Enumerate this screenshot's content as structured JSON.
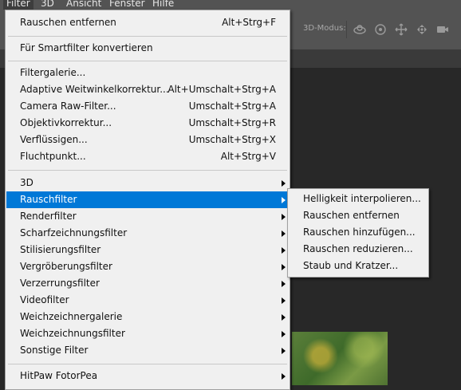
{
  "menubar": {
    "items": [
      "Filter",
      "3D",
      "Ansicht",
      "Fenster",
      "Hilfe"
    ]
  },
  "options_bar": {
    "mode_label": "3D-Modus:",
    "icons": [
      "orbit-icon",
      "roll-icon",
      "pan-icon",
      "slide-icon",
      "camera-icon"
    ]
  },
  "menu": {
    "items": [
      {
        "label": "Rauschen entfernen",
        "shortcut": "Alt+Strg+F"
      },
      {
        "label": "Für Smartfilter konvertieren",
        "shortcut": ""
      },
      {
        "label": "Filtergalerie...",
        "shortcut": ""
      },
      {
        "label": "Adaptive Weitwinkelkorrektur...",
        "shortcut": "Alt+Umschalt+Strg+A"
      },
      {
        "label": "Camera Raw-Filter...",
        "shortcut": "Umschalt+Strg+A"
      },
      {
        "label": "Objektivkorrektur...",
        "shortcut": "Umschalt+Strg+R"
      },
      {
        "label": "Verflüssigen...",
        "shortcut": "Umschalt+Strg+X"
      },
      {
        "label": "Fluchtpunkt...",
        "shortcut": "Alt+Strg+V"
      },
      {
        "label": "3D",
        "shortcut": ""
      },
      {
        "label": "Rauschfilter",
        "shortcut": ""
      },
      {
        "label": "Renderfilter",
        "shortcut": ""
      },
      {
        "label": "Scharfzeichnungsfilter",
        "shortcut": ""
      },
      {
        "label": "Stilisierungsfilter",
        "shortcut": ""
      },
      {
        "label": "Vergröberungsfilter",
        "shortcut": ""
      },
      {
        "label": "Verzerrungsfilter",
        "shortcut": ""
      },
      {
        "label": "Videofilter",
        "shortcut": ""
      },
      {
        "label": "Weichzeichnergalerie",
        "shortcut": ""
      },
      {
        "label": "Weichzeichnungsfilter",
        "shortcut": ""
      },
      {
        "label": "Sonstige Filter",
        "shortcut": ""
      },
      {
        "label": "HitPaw FotorPea",
        "shortcut": ""
      }
    ]
  },
  "submenu": {
    "items": [
      "Helligkeit interpolieren...",
      "Rauschen entfernen",
      "Rauschen hinzufügen...",
      "Rauschen reduzieren...",
      "Staub und Kratzer..."
    ]
  },
  "colors": {
    "highlight": "#0078d7",
    "menu_bg": "#f0f0f0",
    "app_bg": "#282828"
  }
}
